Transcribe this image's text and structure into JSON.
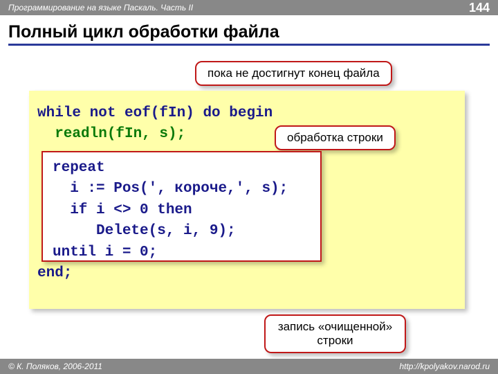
{
  "header": {
    "breadcrumb": "Программирование на языке Паскаль. Часть II",
    "page": "144"
  },
  "title": "Полный цикл обработки файла",
  "callouts": {
    "eof": "пока не достигнут конец файла",
    "process": "обработка строки",
    "write": "запись «очищенной» строки"
  },
  "code": {
    "line1a": "while not eof(fIn) do begin",
    "line2": "  readln(fIn, s);",
    "line_end": "end;",
    "inner1": "repeat",
    "inner2": "  i := Pos(', короче,', s);",
    "inner3": "  if i <> 0 then",
    "inner4": "     Delete(s, i, 9);",
    "inner5": "until i = 0;"
  },
  "footer": {
    "copyright": "© К. Поляков, 2006-2011",
    "url": "http://kpolyakov.narod.ru"
  }
}
